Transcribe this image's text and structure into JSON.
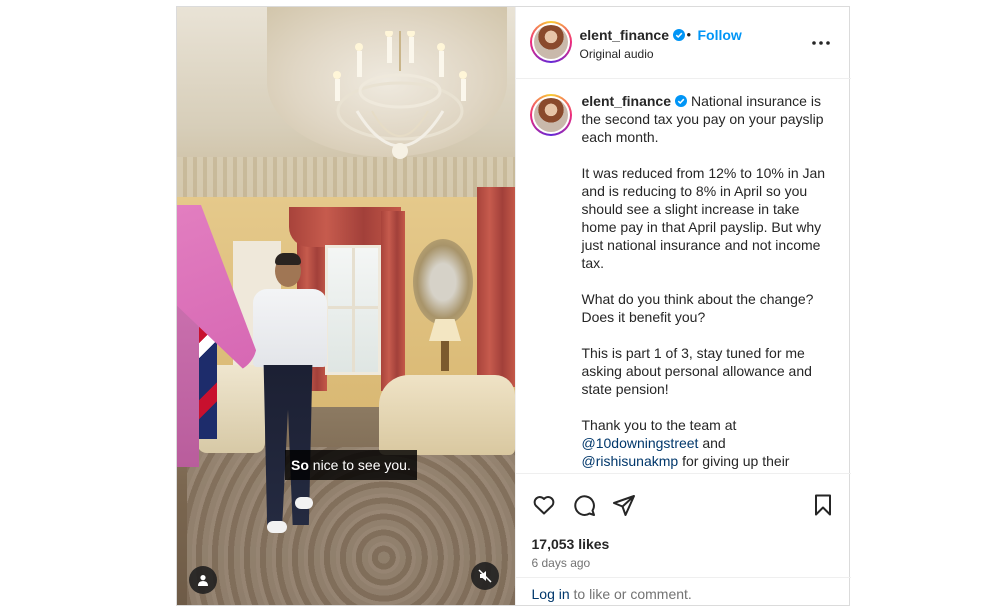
{
  "post": {
    "author": "elent_finance",
    "follow_label": "Follow",
    "separator": "•",
    "audio_label": "Original audio",
    "subtitle_bold": "So",
    "subtitle_rest": " nice to see you.",
    "caption_paragraphs": [
      "National insurance is the second tax you pay on your payslip each month.",
      "It was reduced from 12% to 10% in Jan and is reducing to 8% in April so you should see a slight increase in take home pay in that April payslip. But why just national insurance and not income tax.",
      "What do you think about the change? Does it benefit you?",
      "This is part 1 of 3, stay tuned for me asking about personal allowance and state pension!"
    ],
    "thanks_intro": "Thank you to the team at",
    "mention_1": "@10downingstreet",
    "and_text": " and",
    "mention_2": "@rishisunakmp",
    "thanks_tail": " for giving up their",
    "likes": "17,053 likes",
    "time_ago": "6 days ago",
    "login_link": "Log in",
    "login_rest": " to like or comment."
  },
  "icons": {
    "verified": "verified-badge-icon",
    "more": "more-options-icon",
    "like": "heart-icon",
    "comment": "comment-icon",
    "share": "share-icon",
    "save": "bookmark-icon",
    "user_tags": "user-icon",
    "mute": "muted-speaker-icon"
  },
  "colors": {
    "accent": "#0095f6",
    "link": "#00376b",
    "text": "#262626",
    "muted": "#737373",
    "border": "#dbdbdb"
  }
}
